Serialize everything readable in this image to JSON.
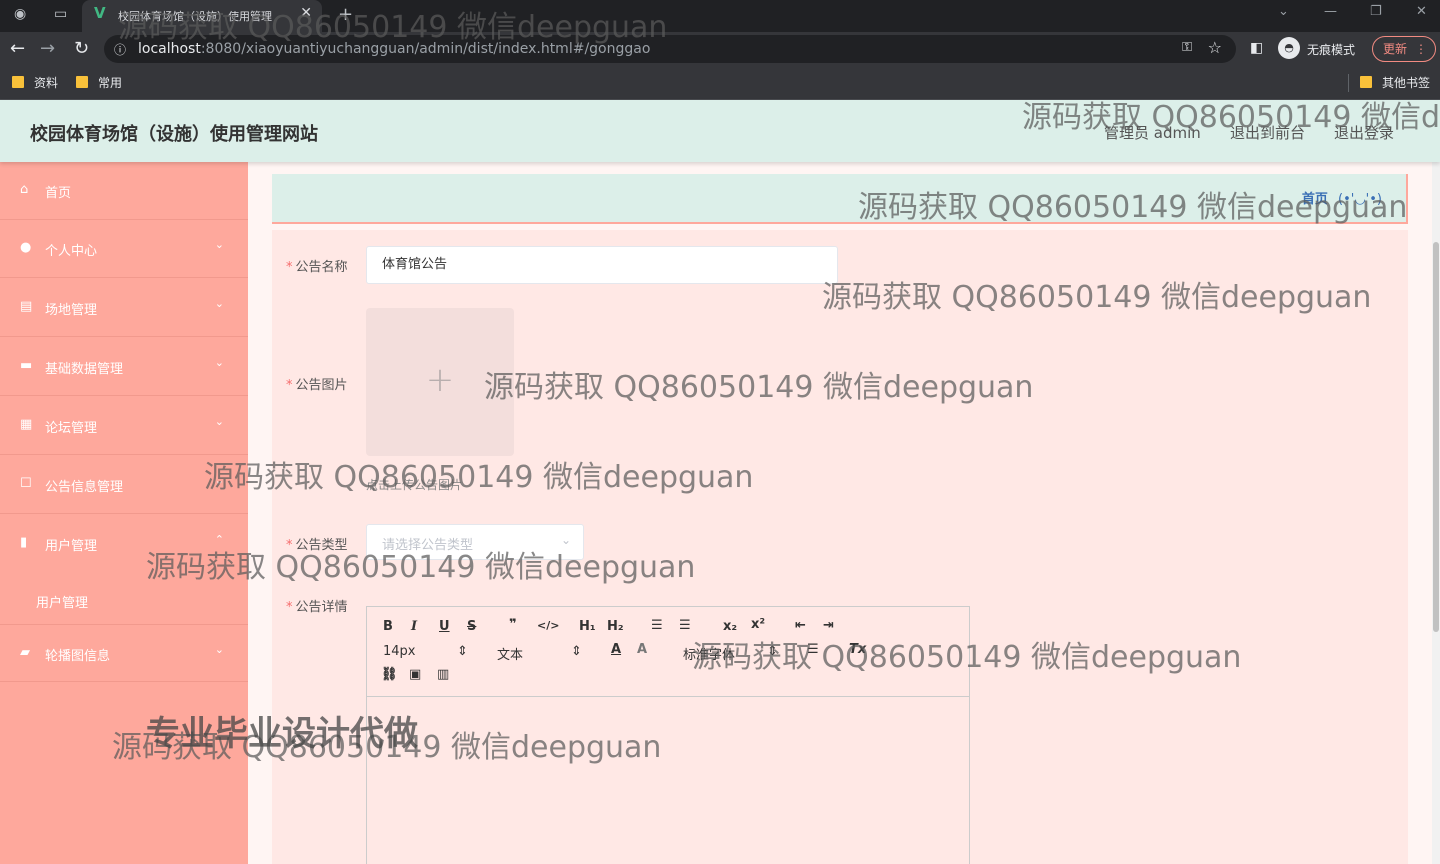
{
  "browser": {
    "tab_title": "校园体育场馆（设施）使用管理",
    "url_host": "localhost",
    "url_rest": ":8080/xiaoyuantiyuchangguan/admin/dist/index.html#/gonggao",
    "incognito_label": "无痕模式",
    "update_label": "更新",
    "bookmarks": [
      "资料",
      "常用"
    ],
    "other_bookmarks": "其他书签"
  },
  "header": {
    "site_title": "校园体育场馆（设施）使用管理网站",
    "admin_label": "管理员 admin",
    "to_frontend": "退出到前台",
    "logout": "退出登录"
  },
  "sidebar": {
    "items": [
      {
        "label": "首页",
        "icon": "home-icon"
      },
      {
        "label": "个人中心",
        "icon": "user-icon"
      },
      {
        "label": "场地管理",
        "icon": "venue-icon"
      },
      {
        "label": "基础数据管理",
        "icon": "ticket-icon"
      },
      {
        "label": "论坛管理",
        "icon": "grid-icon"
      },
      {
        "label": "公告信息管理",
        "icon": "notice-icon"
      },
      {
        "label": "用户管理",
        "icon": "chart-icon"
      },
      {
        "label": "轮播图信息",
        "icon": "carousel-icon"
      }
    ],
    "sub_item": "用户管理"
  },
  "breadcrumb": {
    "home": "首页",
    "face": "(•'◡'•)"
  },
  "form": {
    "name_label": "公告名称",
    "name_value": "体育馆公告",
    "image_label": "公告图片",
    "upload_hint": "点击上传公告图片",
    "type_label": "公告类型",
    "type_placeholder": "请选择公告类型",
    "detail_label": "公告详情"
  },
  "editor": {
    "font_size": "14px",
    "font_style": "文本",
    "heading": "标准字体"
  },
  "watermark": {
    "text": "源码获取 QQ86050149 微信deepguan",
    "slogan": "专业毕业设计代做"
  }
}
